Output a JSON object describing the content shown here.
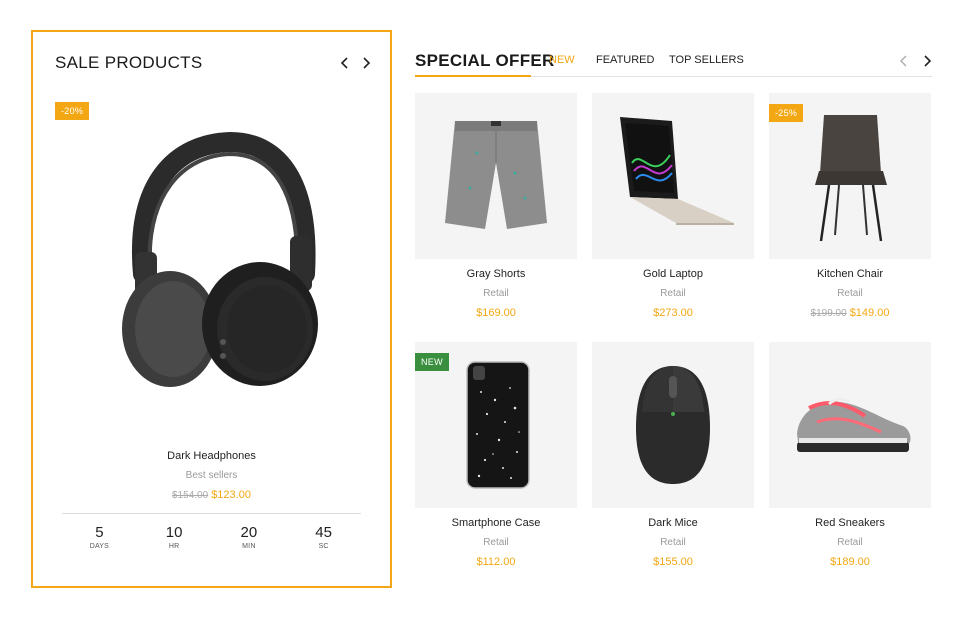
{
  "sale": {
    "title": "SALE PRODUCTS",
    "badge": "-20%",
    "product": {
      "name": "Dark Headphones",
      "category": "Best sellers",
      "old_price": "$154.00",
      "price": "$123.00"
    },
    "countdown": [
      {
        "value": "5",
        "label": "DAYS"
      },
      {
        "value": "10",
        "label": "HR"
      },
      {
        "value": "20",
        "label": "MIN"
      },
      {
        "value": "45",
        "label": "SC"
      }
    ]
  },
  "offer": {
    "title": "SPECIAL OFFER",
    "tabs": [
      {
        "label": "NEW",
        "active": true
      },
      {
        "label": "FEATURED",
        "active": false
      },
      {
        "label": "TOP SELLERS",
        "active": false
      }
    ],
    "products": [
      {
        "name": "Gray Shorts",
        "category": "Retail",
        "price": "$169.00",
        "old_price": "",
        "badge": ""
      },
      {
        "name": "Gold Laptop",
        "category": "Retail",
        "price": "$273.00",
        "old_price": "",
        "badge": ""
      },
      {
        "name": "Kitchen Chair",
        "category": "Retail",
        "price": "$149.00",
        "old_price": "$199.00",
        "badge": "-25%"
      },
      {
        "name": "Smartphone Case",
        "category": "Retail",
        "price": "$112.00",
        "old_price": "",
        "badge": "NEW"
      },
      {
        "name": "Dark Mice",
        "category": "Retail",
        "price": "$155.00",
        "old_price": "",
        "badge": ""
      },
      {
        "name": "Red Sneakers",
        "category": "Retail",
        "price": "$189.00",
        "old_price": "",
        "badge": ""
      }
    ]
  },
  "colors": {
    "accent": "#f3a712",
    "new_badge": "#3a8f3f",
    "muted_text": "#9a9a9a",
    "thumb_bg": "#f4f4f4"
  },
  "icons": {
    "prev": "chevron-left-icon",
    "next": "chevron-right-icon"
  }
}
